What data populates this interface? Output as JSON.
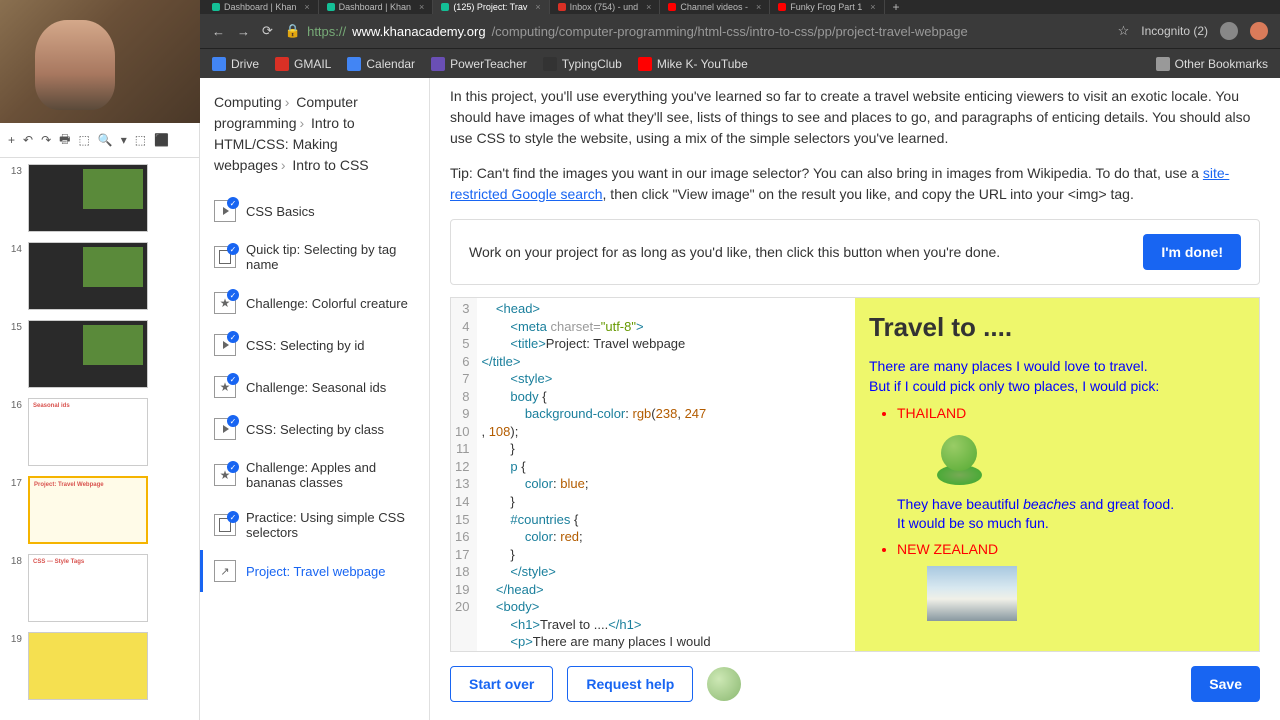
{
  "tabs": [
    {
      "label": "Dashboard | Khan",
      "ico": "#14bf96"
    },
    {
      "label": "Dashboard | Khan",
      "ico": "#14bf96"
    },
    {
      "label": "(125) Project: Trav",
      "ico": "#14bf96",
      "active": true
    },
    {
      "label": "Inbox (754) - und",
      "ico": "#d93025"
    },
    {
      "label": "Channel videos -",
      "ico": "#ff0000"
    },
    {
      "label": "Funky Frog Part 1",
      "ico": "#ff0000"
    }
  ],
  "addr": {
    "scheme": "https://",
    "domain": "www.khanacademy.org",
    "path": "/computing/computer-programming/html-css/intro-to-css/pp/project-travel-webpage",
    "incognito": "Incognito (2)"
  },
  "bookmarks": [
    {
      "label": "Drive",
      "ico": "#4285f4"
    },
    {
      "label": "GMAIL",
      "ico": "#d93025"
    },
    {
      "label": "Calendar",
      "ico": "#4285f4"
    },
    {
      "label": "PowerTeacher",
      "ico": "#6a4fb5"
    },
    {
      "label": "TypingClub",
      "ico": "#333"
    },
    {
      "label": "Mike K- YouTube",
      "ico": "#ff0000"
    }
  ],
  "other_bookmarks": "Other Bookmarks",
  "slides_toolbar": [
    "+",
    "↶",
    "↷",
    "🖶",
    "⬚",
    "🔍",
    "▾",
    "⬚",
    "⬛"
  ],
  "slides": [
    {
      "num": "13",
      "variant": "dark"
    },
    {
      "num": "14",
      "variant": "dark"
    },
    {
      "num": "15",
      "variant": "dark"
    },
    {
      "num": "16",
      "variant": "plain",
      "title": "Seasonal ids"
    },
    {
      "num": "17",
      "variant": "active",
      "title": "Project: Travel Webpage"
    },
    {
      "num": "18",
      "variant": "plain",
      "title": "CSS --- Style Tags"
    },
    {
      "num": "19",
      "variant": "yellow"
    }
  ],
  "breadcrumbs": [
    "Computing",
    "Computer programming",
    "Intro to HTML/CSS: Making webpages",
    "Intro to CSS"
  ],
  "lessons": [
    {
      "label": "CSS Basics",
      "ico": "play",
      "done": true
    },
    {
      "label": "Quick tip: Selecting by tag name",
      "ico": "doc",
      "done": true
    },
    {
      "label": "Challenge: Colorful creature",
      "ico": "star",
      "done": true
    },
    {
      "label": "CSS: Selecting by id",
      "ico": "play",
      "done": true
    },
    {
      "label": "Challenge: Seasonal ids",
      "ico": "star",
      "done": true
    },
    {
      "label": "CSS: Selecting by class",
      "ico": "play",
      "done": true
    },
    {
      "label": "Challenge: Apples and bananas classes",
      "ico": "star",
      "done": true
    },
    {
      "label": "Practice: Using simple CSS selectors",
      "ico": "doc",
      "done": true
    },
    {
      "label": "Project: Travel webpage",
      "ico": "proj",
      "done": false,
      "active": true
    }
  ],
  "intro": "In this project, you'll use everything you've learned so far to create a travel website enticing viewers to visit an exotic locale. You should have images of what they'll see, lists of things to see and places to go, and paragraphs of enticing details. You should also use CSS to style the website, using a mix of the simple selectors you've learned.",
  "tip_pre": "Tip: Can't find the images you want in our image selector? You can also bring in images from Wikipedia. To do that, use a ",
  "tip_link1": "site-restricted Google search",
  "tip_post": ", then click \"View image\" on the result you like, and copy the URL into your <img> tag.",
  "done_msg": "Work on your project for as long as you'd like, then click this button when you're done.",
  "btn_done": "I'm done!",
  "btn_start": "Start over",
  "btn_help": "Request help",
  "btn_save": "Save",
  "code_lines": [
    "3",
    "4",
    "5",
    "6",
    "7",
    "8",
    "9",
    "10",
    "11",
    "12",
    "13",
    "14",
    "15",
    "16",
    "17",
    "18",
    "19",
    "20"
  ],
  "preview": {
    "h1": "Travel to ....",
    "p1": "There are many places I would love to travel.",
    "p2": "But if I could pick only two places, I would pick:",
    "li1": "THAILAND",
    "li1_body1": "They have beautiful ",
    "li1_em": "beaches",
    "li1_body2": " and great food.",
    "li1_body3": "It would be so much fun.",
    "li2": "NEW ZEALAND"
  }
}
